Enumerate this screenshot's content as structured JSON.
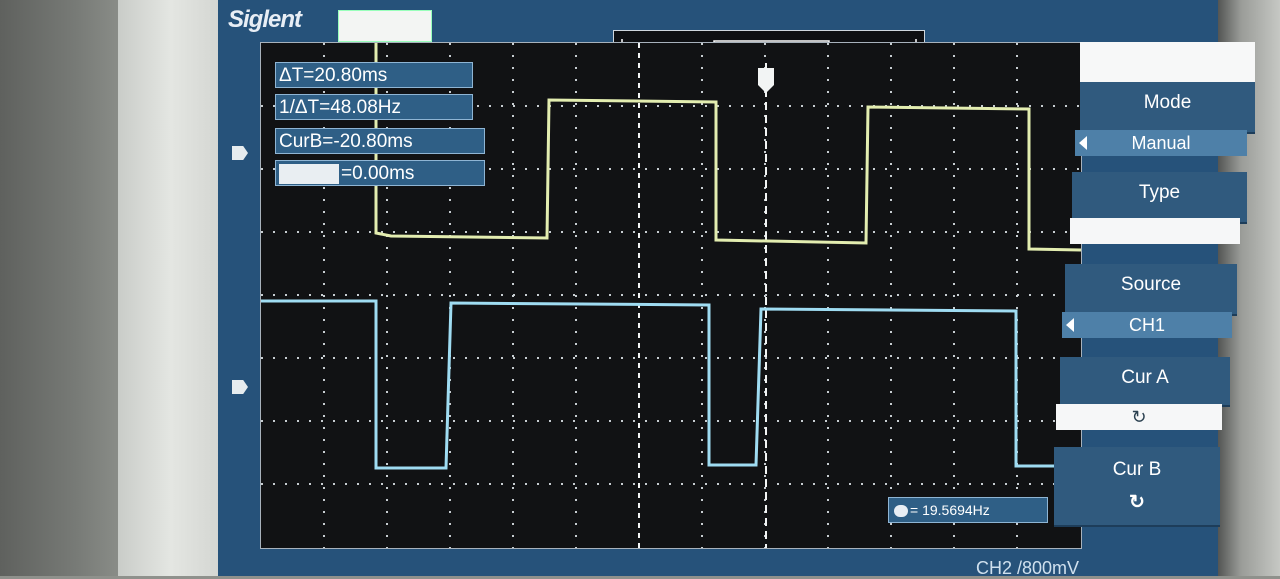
{
  "brand": "Siglent",
  "cursor_readouts": [
    {
      "text": "ΔT=20.80ms"
    },
    {
      "text": "1/ΔT=48.08Hz"
    },
    {
      "text": "CurB=-20.80ms"
    },
    {
      "text": "=0.00ms"
    }
  ],
  "frequency_readout": "= 19.5694Hz",
  "menu": {
    "mode_label": "Mode",
    "mode_value": "Manual",
    "type_label": "Type",
    "type_value": "",
    "source_label": "Source",
    "source_value": "CH1",
    "cur_a_label": "Cur A",
    "cur_a_icon": "rotate-knob-icon",
    "cur_a_symbol": "↻",
    "cur_b_label": "Cur B",
    "cur_b_icon": "rotate-knob-icon",
    "cur_b_symbol": "↻"
  },
  "bottom_status": "CH2 /800mV",
  "colors": {
    "ch1_trace": "#e3edb0",
    "ch2_trace": "#9fdcf2",
    "screen_bg": "#26527a",
    "grid_bg": "#111214"
  }
}
